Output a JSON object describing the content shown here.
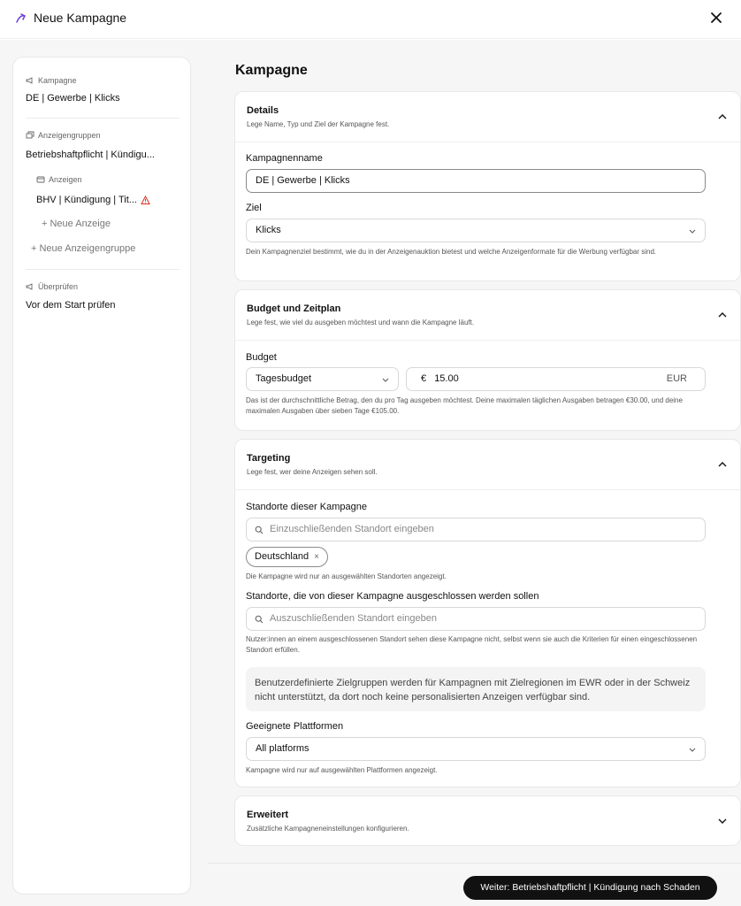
{
  "header": {
    "title": "Neue Kampagne",
    "logo_icon": "hook-logo-icon",
    "close_icon": "close-icon"
  },
  "sidebar": {
    "campaign_section": "Kampagne",
    "campaign_name": "DE | Gewerbe | Klicks",
    "adgroups_section": "Anzeigengruppen",
    "adgroup_name": "Betriebshaftpflicht | Kündigu...",
    "ads_section": "Anzeigen",
    "ad_name": "BHV | Kündigung | Tit...",
    "new_ad": "+  Neue Anzeige",
    "new_adgroup": "+  Neue Anzeigengruppe",
    "review_section": "Überprüfen",
    "review_item": "Vor dem Start prüfen",
    "warning_color": "#d92d20"
  },
  "main": {
    "title": "Kampagne",
    "details": {
      "title": "Details",
      "subtitle": "Lege Name, Typ und Ziel der Kampagne fest.",
      "name_label": "Kampagnenname",
      "name_value": "DE | Gewerbe | Klicks",
      "goal_label": "Ziel",
      "goal_value": "Klicks",
      "goal_help": "Dein Kampagnenziel bestimmt, wie du in der Anzeigenauktion bietest und welche Anzeigenformate für die Werbung verfügbar sind."
    },
    "budget": {
      "title": "Budget und Zeitplan",
      "subtitle": "Lege fest, wie viel du ausgeben möchtest und wann die Kampagne läuft.",
      "label": "Budget",
      "type_value": "Tagesbudget",
      "currency_symbol": "€",
      "amount": "15.00",
      "currency": "EUR",
      "help": "Das ist der durchschnittliche Betrag, den du pro Tag ausgeben möchtest. Deine maximalen täglichen Ausgaben betragen €30.00, und deine maximalen Ausgaben über sieben Tage €105.00."
    },
    "targeting": {
      "title": "Targeting",
      "subtitle": "Lege fest, wer deine Anzeigen sehen soll.",
      "include_label": "Standorte dieser Kampagne",
      "include_placeholder": "Einzuschließenden Standort eingeben",
      "chip": "Deutschland",
      "chip_remove": "×",
      "include_help": "Die Kampagne wird nur an ausgewählten Standorten angezeigt.",
      "exclude_label": "Standorte, die von dieser Kampagne ausgeschlossen werden sollen",
      "exclude_placeholder": "Auszuschließenden Standort eingeben",
      "exclude_help": "Nutzer:innen an einem ausgeschlossenen Standort sehen diese Kampagne nicht, selbst wenn sie auch die Kriterien für einen eingeschlossenen Standort erfüllen.",
      "info": "Benutzerdefinierte Zielgruppen werden für Kampagnen mit Zielregionen im EWR oder in der Schweiz nicht unterstützt, da dort noch keine personalisierten Anzeigen verfügbar sind.",
      "platforms_label": "Geeignete Plattformen",
      "platforms_value": "All platforms",
      "platforms_help": "Kampagne wird nur auf ausgewählten Plattformen angezeigt."
    },
    "advanced": {
      "title": "Erweitert",
      "subtitle": "Zusätzliche Kampagneneinstellungen konfigurieren."
    }
  },
  "footer": {
    "next_button": "Weiter: Betriebshaftpflicht | Kündigung nach Schaden"
  }
}
